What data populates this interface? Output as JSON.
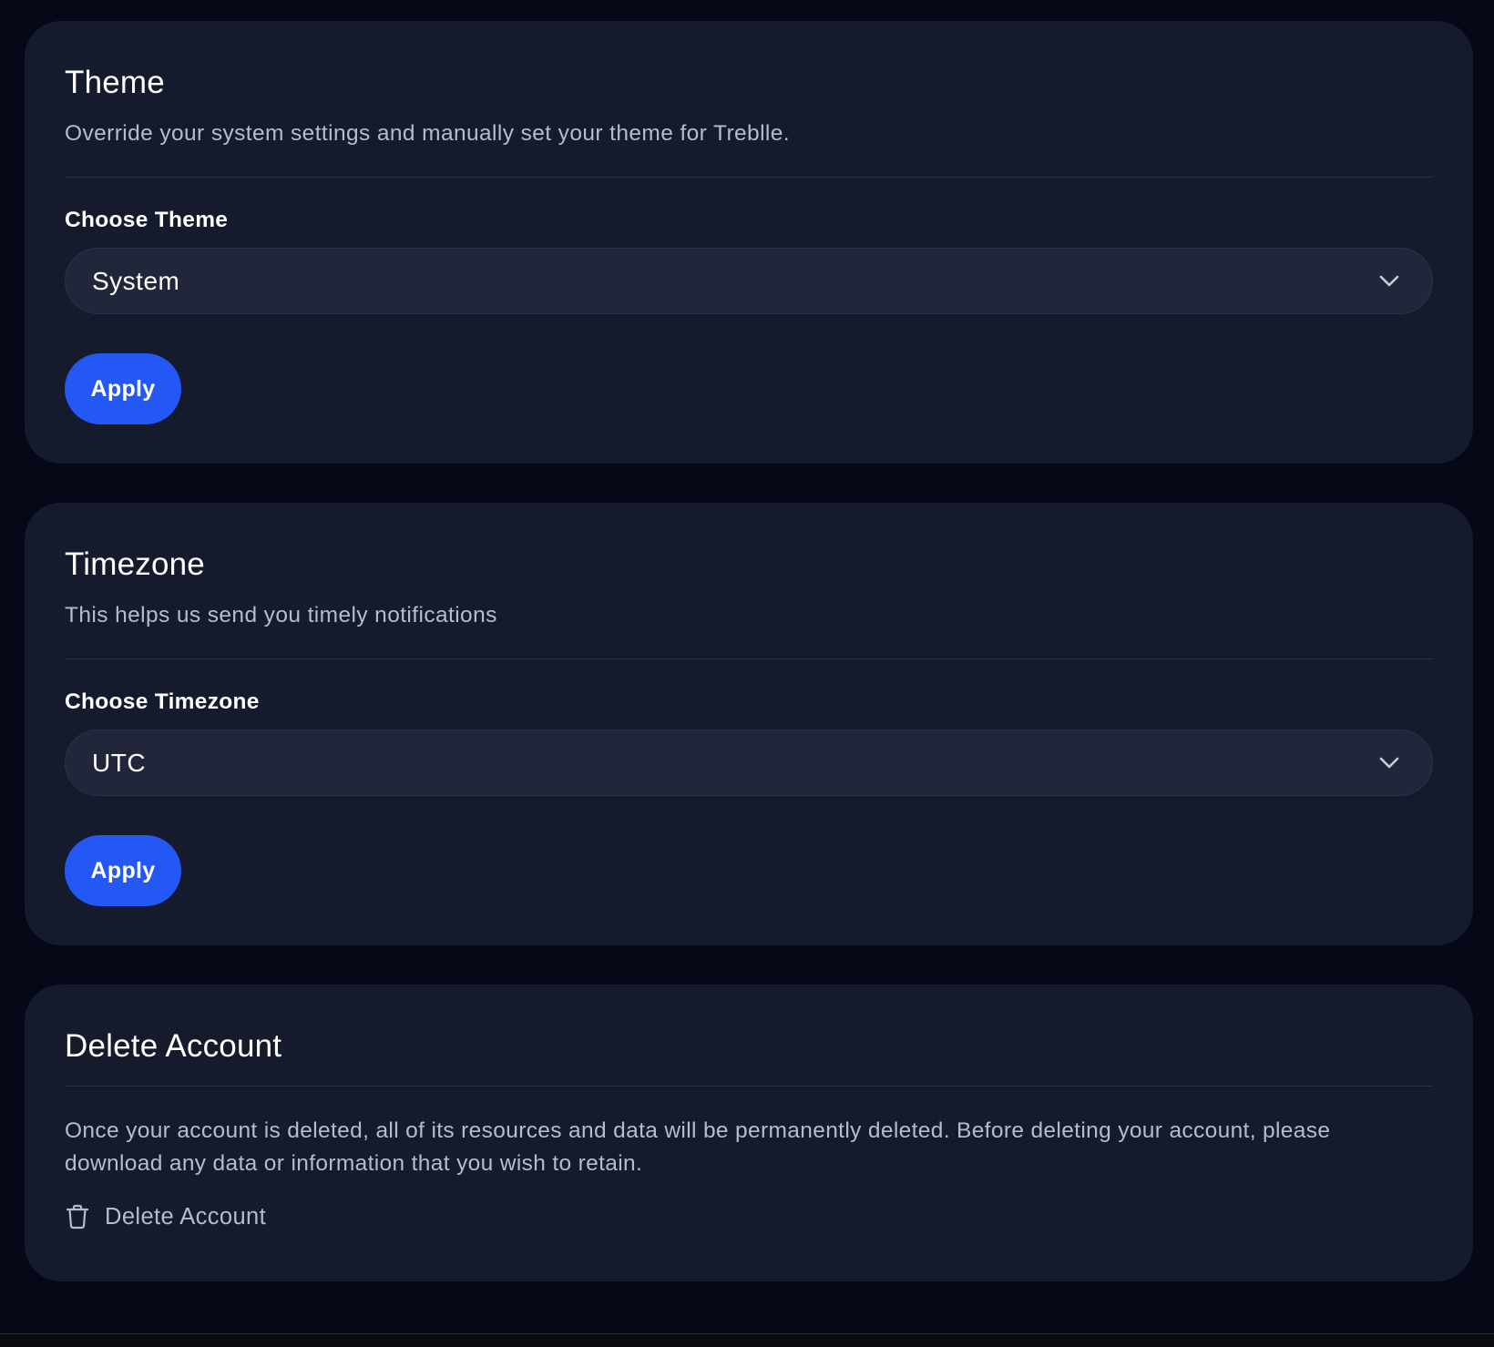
{
  "theme": {
    "title": "Theme",
    "description": "Override your system settings and manually set your theme for Treblle.",
    "field_label": "Choose Theme",
    "selected_value": "System",
    "apply_label": "Apply"
  },
  "timezone": {
    "title": "Timezone",
    "description": "This helps us send you timely notifications",
    "field_label": "Choose Timezone",
    "selected_value": "UTC",
    "apply_label": "Apply"
  },
  "delete_account": {
    "title": "Delete Account",
    "body": "Once your account is deleted, all of its resources and data will be permanently deleted. Before deleting your account, please download any data or information that you wish to retain.",
    "action_label": "Delete Account",
    "action_icon": "trash-icon"
  },
  "colors": {
    "background": "#050817",
    "card": "#161a2d",
    "select": "#22263b",
    "accent": "#2458f5",
    "text_primary": "#ffffff",
    "text_secondary": "#b6bccb"
  }
}
